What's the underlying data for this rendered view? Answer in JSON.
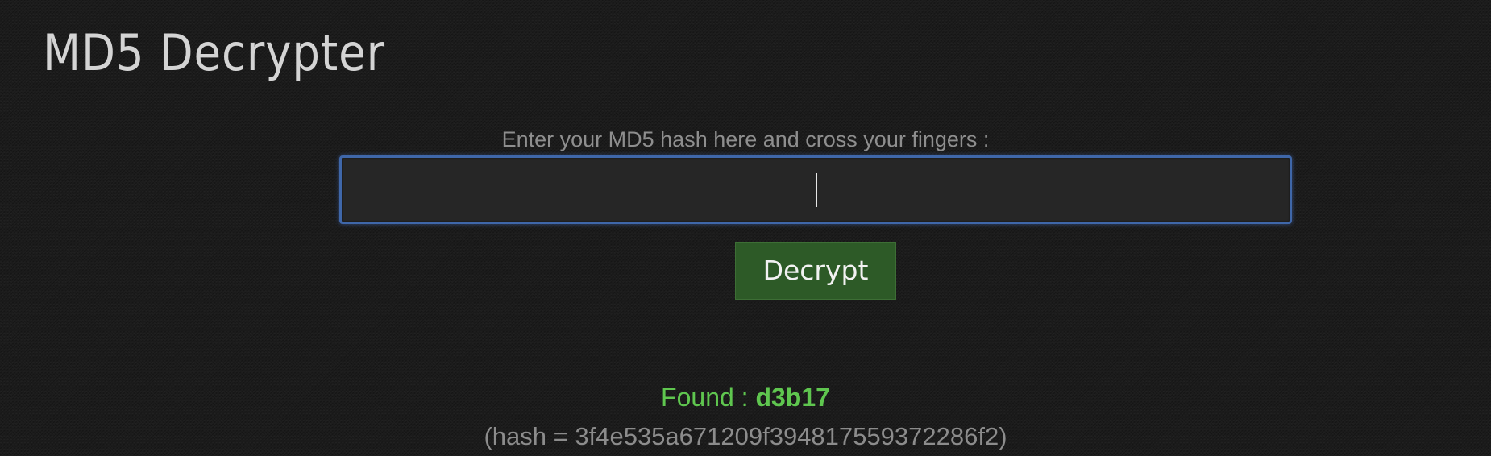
{
  "header": {
    "title": "MD5 Decrypter"
  },
  "form": {
    "prompt": "Enter your MD5 hash here and cross your fingers :",
    "input_value": "",
    "input_placeholder": "",
    "button_label": "Decrypt"
  },
  "result": {
    "found_label": "Found : ",
    "found_value": "d3b17",
    "hash_prefix": "(hash = ",
    "hash_value": "3f4e535a671209f394817559372286f2",
    "hash_suffix": ")"
  },
  "colors": {
    "background": "#1b1b1b",
    "input_border": "#3f67a9",
    "button_bg": "#2d5a27",
    "found_text": "#5fc64f",
    "muted_text": "#8c8c8c"
  }
}
